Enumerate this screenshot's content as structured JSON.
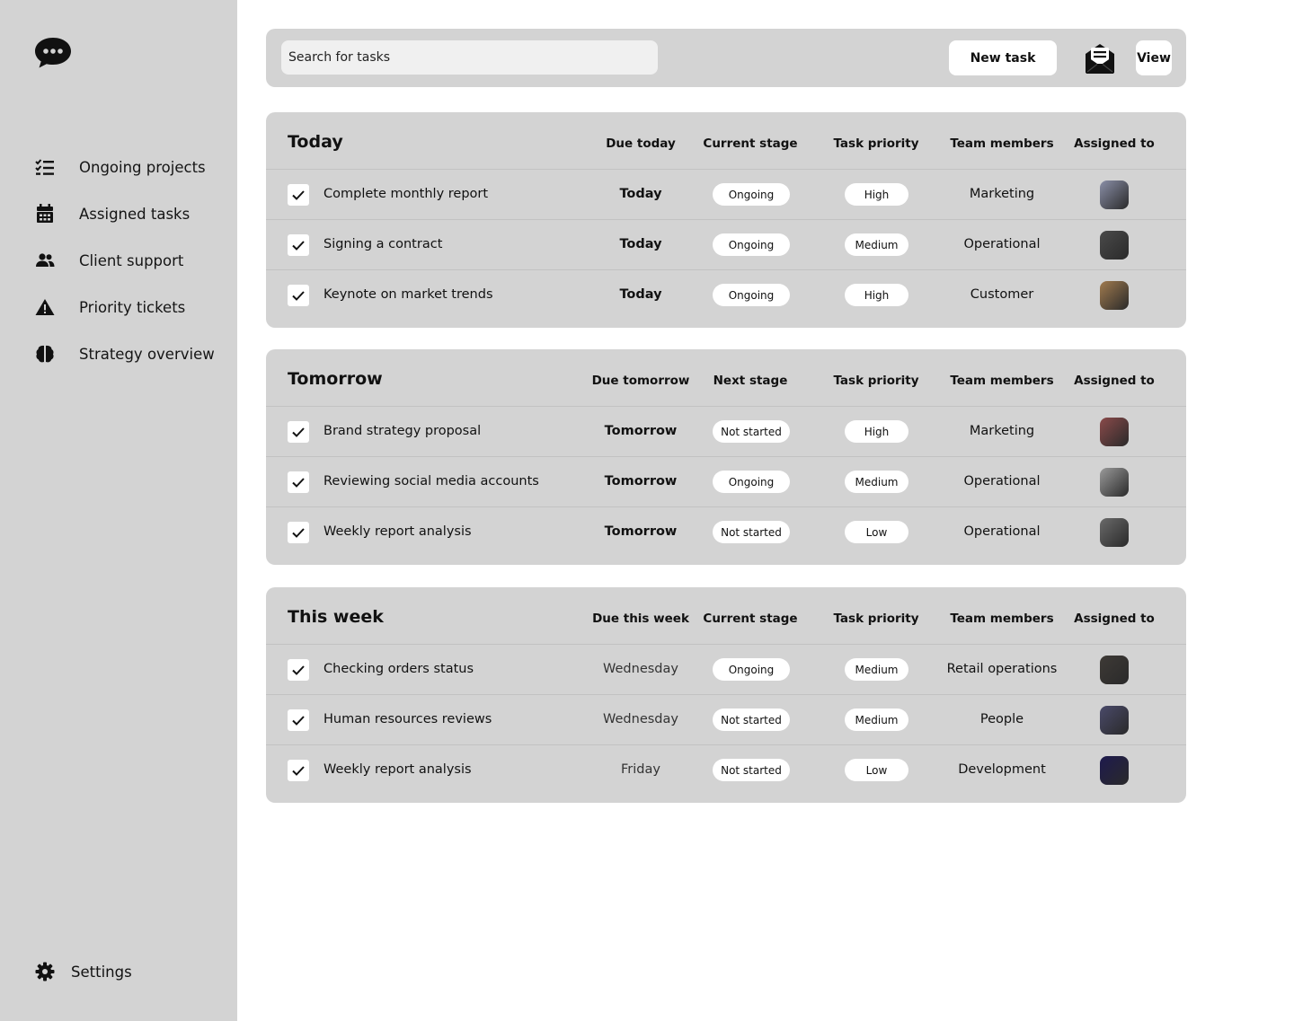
{
  "search": {
    "placeholder": "Search for tasks"
  },
  "toolbar": {
    "new_task_label": "New task",
    "view_label": "View"
  },
  "sidebar": {
    "items": [
      {
        "label": "Ongoing projects",
        "icon": "list-check-icon"
      },
      {
        "label": "Assigned tasks",
        "icon": "calendar-icon"
      },
      {
        "label": "Client support",
        "icon": "users-icon"
      },
      {
        "label": "Priority tickets",
        "icon": "warning-icon"
      },
      {
        "label": "Strategy overview",
        "icon": "brain-icon"
      }
    ],
    "settings_label": "Settings"
  },
  "sections": [
    {
      "title": "Today",
      "columns": {
        "due": "Due today",
        "stage": "Current stage",
        "priority": "Task priority",
        "team": "Team members",
        "assigned": "Assigned to"
      },
      "rows": [
        {
          "task": "Complete monthly report",
          "due": "Today",
          "stage": "Ongoing",
          "priority": "High",
          "team": "Marketing",
          "avatar_color": "#8a8fa8"
        },
        {
          "task": "Signing a contract",
          "due": "Today",
          "stage": "Ongoing",
          "priority": "Medium",
          "team": "Operational",
          "avatar_color": "#4a4a4a"
        },
        {
          "task": "Keynote on market trends",
          "due": "Today",
          "stage": "Ongoing",
          "priority": "High",
          "team": "Customer",
          "avatar_color": "#a07a4e"
        }
      ]
    },
    {
      "title": "Tomorrow",
      "columns": {
        "due": "Due tomorrow",
        "stage": "Next stage",
        "priority": "Task priority",
        "team": "Team members",
        "assigned": "Assigned to"
      },
      "rows": [
        {
          "task": "Brand strategy proposal",
          "due": "Tomorrow",
          "stage": "Not started",
          "priority": "High",
          "team": "Marketing",
          "avatar_color": "#8a4a4a"
        },
        {
          "task": "Reviewing social media accounts",
          "due": "Tomorrow",
          "stage": "Ongoing",
          "priority": "Medium",
          "team": "Operational",
          "avatar_color": "#9a9a9a"
        },
        {
          "task": "Weekly report analysis",
          "due": "Tomorrow",
          "stage": "Not started",
          "priority": "Low",
          "team": "Operational",
          "avatar_color": "#6a6a6a"
        }
      ]
    },
    {
      "title": "This week",
      "columns": {
        "due": "Due this week",
        "stage": "Current stage",
        "priority": "Task priority",
        "team": "Team members",
        "assigned": "Assigned to"
      },
      "rows": [
        {
          "task": "Checking orders status",
          "due": "Wednesday",
          "stage": "Ongoing",
          "priority": "Medium",
          "team": "Retail operations",
          "avatar_color": "#3e3a36"
        },
        {
          "task": "Human resources reviews",
          "due": "Wednesday",
          "stage": "Not started",
          "priority": "Medium",
          "team": "People",
          "avatar_color": "#4a4a6a"
        },
        {
          "task": "Weekly report analysis",
          "due": "Friday",
          "stage": "Not started",
          "priority": "Low",
          "team": "Development",
          "avatar_color": "#1e1a4e"
        }
      ]
    }
  ]
}
